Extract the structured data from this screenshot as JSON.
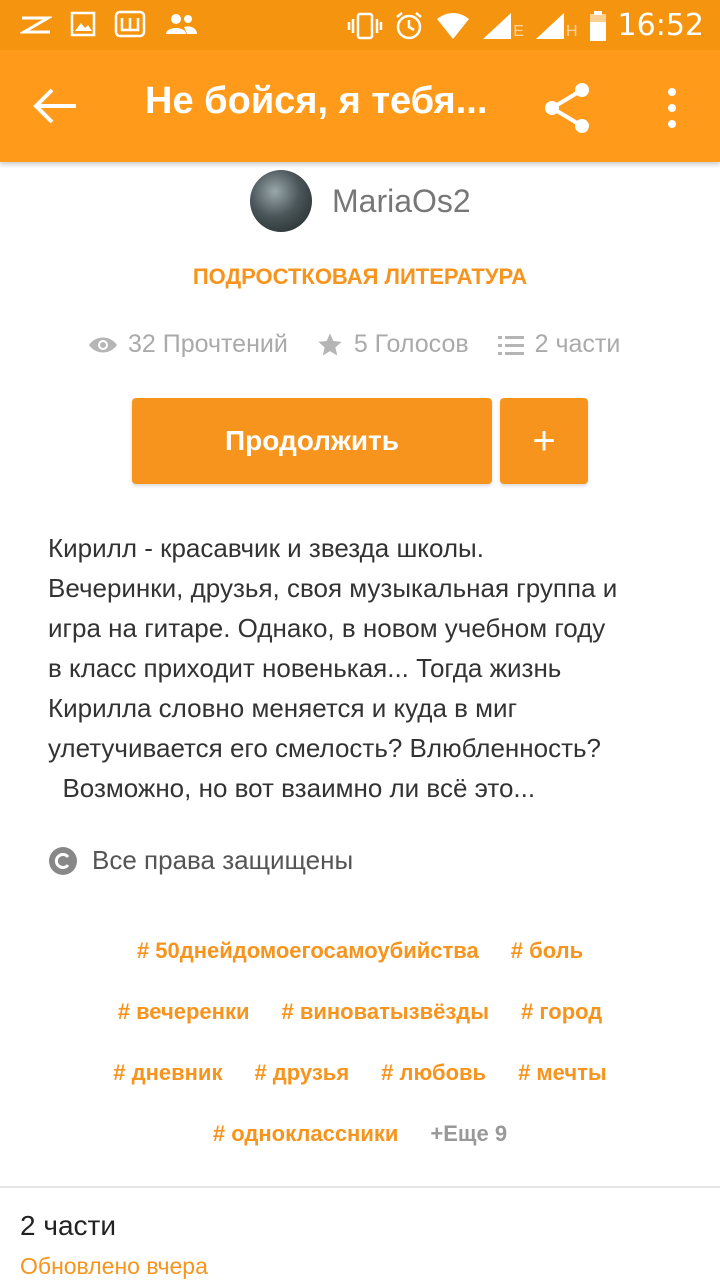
{
  "status_bar": {
    "time": "16:52",
    "network_labels": [
      "E",
      "H"
    ]
  },
  "app_bar": {
    "title": "Не бойся, я тебя..."
  },
  "author": {
    "name": "MariaOs2"
  },
  "category": "ПОДРОСТКОВАЯ ЛИТЕРАТУРА",
  "stats": {
    "reads": "32 Прочтений",
    "votes": "5 Голосов",
    "parts": "2 части"
  },
  "buttons": {
    "continue": "Продолжить",
    "add": "+"
  },
  "description": [
    "Кирилл - красавчик и звезда школы.",
    "Вечеринки, друзья, своя музыкальная группа и",
    "игра на гитаре. Однако, в новом учебном году",
    "в класс приходит новенькая... Тогда жизнь",
    "Кирилла словно меняется и куда в миг",
    "улетучивается его смелость? Влюбленность?",
    "  Возможно, но вот взаимно ли всё это..."
  ],
  "rights": "Все права защищены",
  "tags": [
    [
      "# 50днейдомоегосамоубийства",
      "# боль"
    ],
    [
      "# вечеренки",
      "# виноватызвёзды",
      "# город"
    ],
    [
      "# дневник",
      "# друзья",
      "# любовь",
      "# мечты"
    ],
    [
      "# одноклассники"
    ]
  ],
  "more_tags": "+Еще 9",
  "parts_section": {
    "title": "2 части",
    "updated": "Обновлено вчера"
  },
  "colors": {
    "accent": "#f7941d",
    "appbar": "#ff9a1a",
    "statusbar": "#f5950f"
  }
}
